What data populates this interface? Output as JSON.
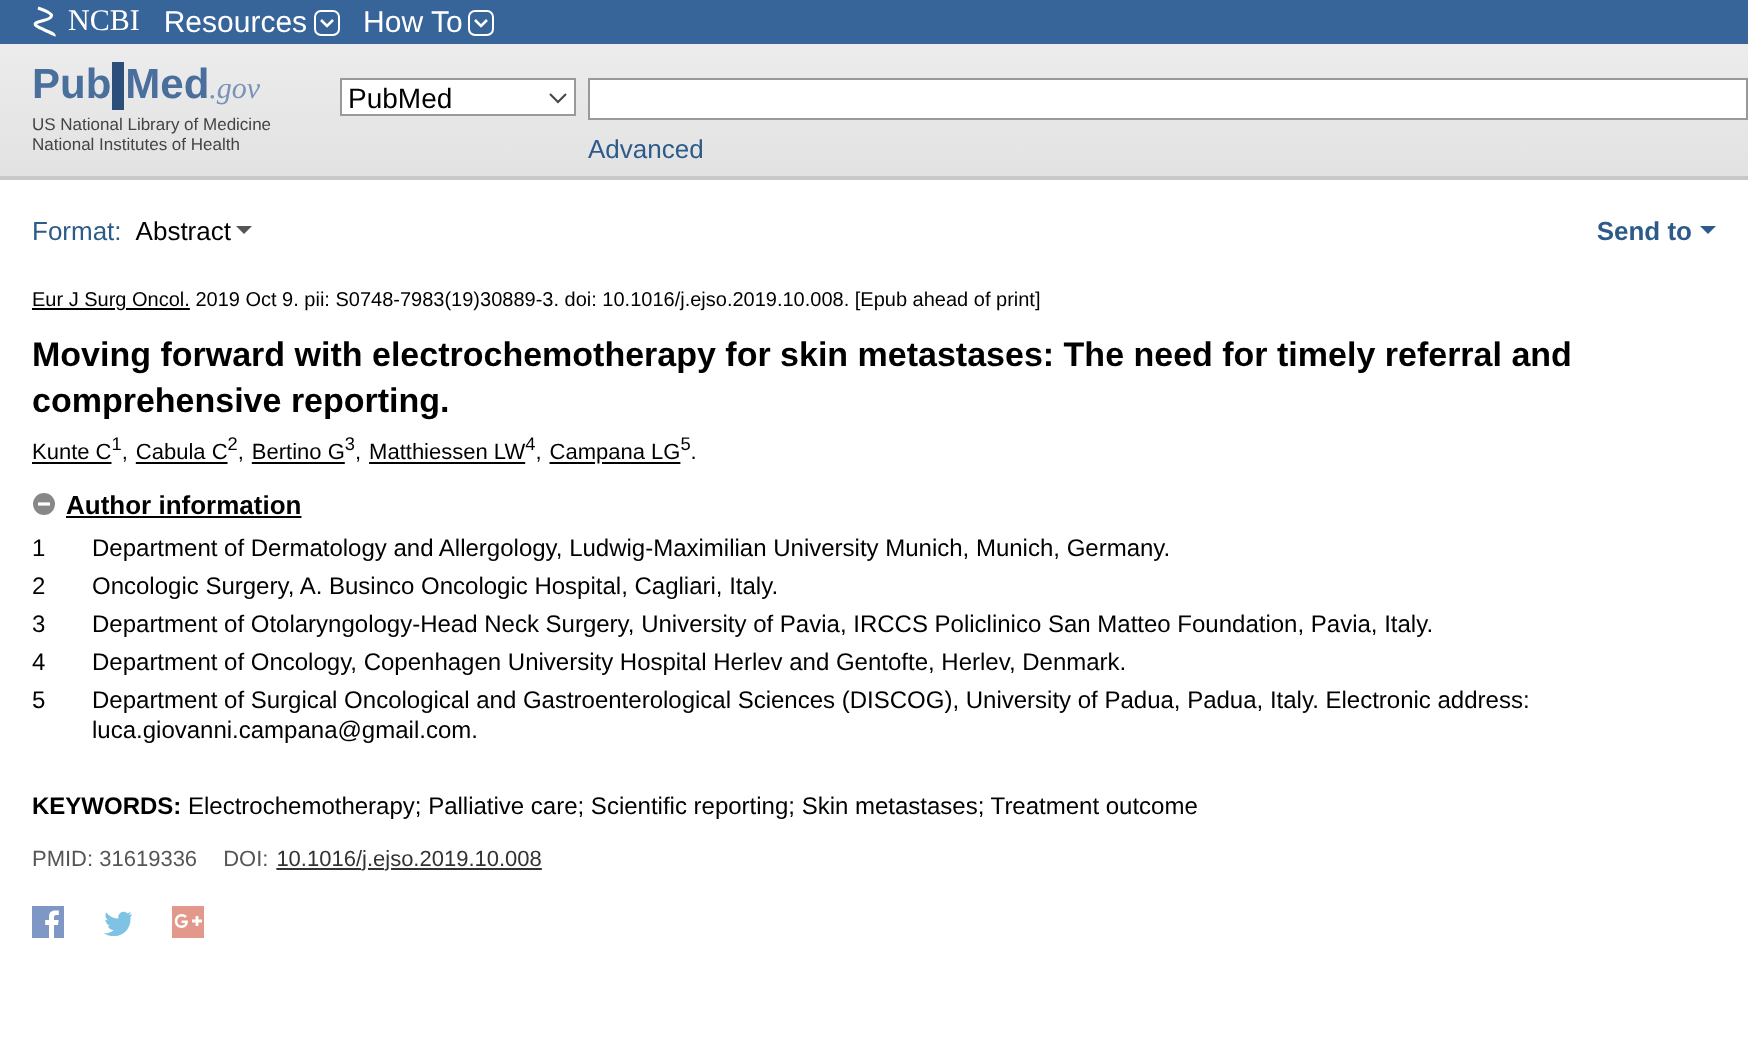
{
  "topbar": {
    "brand": "NCBI",
    "menus": [
      {
        "label": "Resources"
      },
      {
        "label": "How To"
      }
    ]
  },
  "header": {
    "logo": {
      "part_1": "Pub",
      "part_2": "Med",
      "part_3": ".gov"
    },
    "org_lines": [
      "US National Library of Medicine",
      "National Institutes of Health"
    ],
    "database": "PubMed",
    "advanced": "Advanced"
  },
  "toolbar": {
    "format_label": "Format:",
    "format_value": "Abstract",
    "send_to": "Send to"
  },
  "citation": {
    "journal": "Eur J Surg Oncol.",
    "details": "2019 Oct 9. pii: S0748-7983(19)30889-3. doi: 10.1016/j.ejso.2019.10.008. [Epub ahead of print]"
  },
  "title": "Moving forward with electrochemotherapy for skin metastases: The need for timely referral and comprehensive reporting.",
  "authors": [
    {
      "name": "Kunte C",
      "ref": "1",
      "separator": ","
    },
    {
      "name": "Cabula C",
      "ref": "2",
      "separator": ","
    },
    {
      "name": "Bertino G",
      "ref": "3",
      "separator": ","
    },
    {
      "name": "Matthiessen LW",
      "ref": "4",
      "separator": ","
    },
    {
      "name": "Campana LG",
      "ref": "5",
      "separator": "."
    }
  ],
  "author_info": {
    "label": "Author information",
    "expanded": true,
    "affiliations": [
      {
        "number": "1",
        "text": "Department of Dermatology and Allergology, Ludwig-Maximilian University Munich, Munich, Germany."
      },
      {
        "number": "2",
        "text": "Oncologic Surgery, A. Businco Oncologic Hospital, Cagliari, Italy."
      },
      {
        "number": "3",
        "text": "Department of Otolaryngology-Head Neck Surgery, University of Pavia, IRCCS Policlinico San Matteo Foundation, Pavia, Italy."
      },
      {
        "number": "4",
        "text": "Department of Oncology, Copenhagen University Hospital Herlev and Gentofte, Herlev, Denmark."
      },
      {
        "number": "5",
        "text": "Department of Surgical Oncological and Gastroenterological Sciences (DISCOG), University of Padua, Padua, Italy. Electronic address: luca.giovanni.campana@gmail.com."
      }
    ]
  },
  "keywords": {
    "label": "KEYWORDS:",
    "text": "Electrochemotherapy; Palliative care; Scientific reporting; Skin metastases; Treatment outcome"
  },
  "ids": {
    "pmid": "PMID: 31619336",
    "doi_label": "DOI:",
    "doi": "10.1016/j.ejso.2019.10.008"
  },
  "share": [
    {
      "kind": "facebook"
    },
    {
      "kind": "twitter"
    },
    {
      "kind": "googleplus"
    }
  ]
}
